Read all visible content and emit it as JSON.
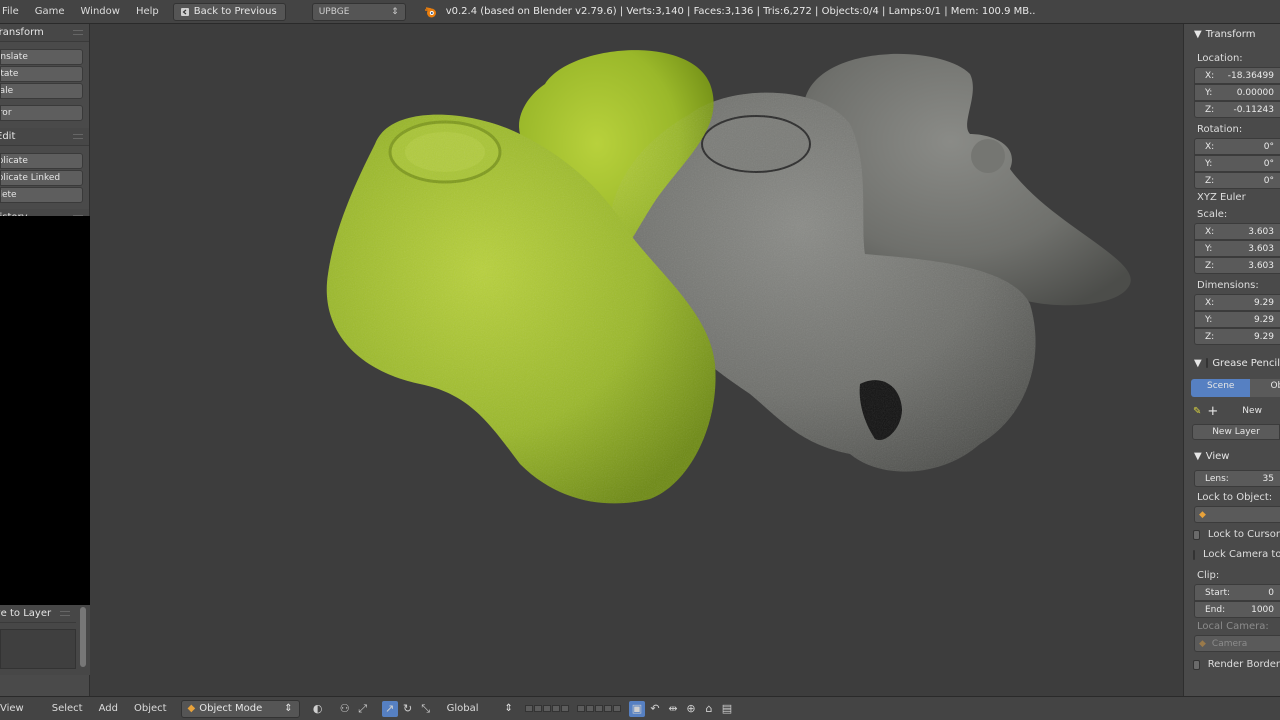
{
  "menu": [
    "File",
    "Game",
    "Window",
    "Help"
  ],
  "back_button": "Back to Previous",
  "engine": "UPBGE",
  "stats": "v0.2.4 (based on Blender v2.79.6) | Verts:3,140 | Faces:3,136 | Tris:6,272 | Objects:0/4 | Lamps:0/1 | Mem: 100.9 MB..",
  "left_panel": {
    "transform_header": "Transform",
    "transform_buttons": [
      "Translate",
      "Rotate",
      "Scale"
    ],
    "mirror": "Mirror",
    "edit_header": "Edit",
    "edit_buttons": [
      "Duplicate",
      "Duplicate Linked",
      "Delete"
    ],
    "history_header": "History",
    "layer_header": "Move to Layer"
  },
  "right_panel": {
    "transform_header": "Transform",
    "location_label": "Location:",
    "location": [
      {
        "axis": "X:",
        "value": "-18.36499"
      },
      {
        "axis": "Y:",
        "value": "0.00000"
      },
      {
        "axis": "Z:",
        "value": "-0.11243"
      }
    ],
    "rotation_label": "Rotation:",
    "rotation": [
      {
        "axis": "X:",
        "value": "0°"
      },
      {
        "axis": "Y:",
        "value": "0°"
      },
      {
        "axis": "Z:",
        "value": "0°"
      }
    ],
    "rotation_mode": "XYZ Euler",
    "scale_label": "Scale:",
    "scale": [
      {
        "axis": "X:",
        "value": "3.603"
      },
      {
        "axis": "Y:",
        "value": "3.603"
      },
      {
        "axis": "Z:",
        "value": "3.603"
      }
    ],
    "dimensions_label": "Dimensions:",
    "dimensions": [
      {
        "axis": "X:",
        "value": "9.29"
      },
      {
        "axis": "Y:",
        "value": "9.29"
      },
      {
        "axis": "Z:",
        "value": "9.29"
      }
    ],
    "grease_header": "Grease Pencil",
    "scene_tab": "Scene",
    "object_tab": "Object",
    "new_label": "New",
    "new_layer": "New Layer",
    "view_header": "View",
    "lens_label": "Lens:",
    "lens_value": "35",
    "lock_object_label": "Lock to Object:",
    "lock_cursor": "Lock to Cursor",
    "lock_camera": "Lock Camera to View",
    "clip_label": "Clip:",
    "clip_start_label": "Start:",
    "clip_start_value": "0",
    "clip_end_label": "End:",
    "clip_end_value": "1000",
    "local_camera_label": "Local Camera:",
    "camera_value": "Camera",
    "render_border": "Render Border"
  },
  "bottom_bar": {
    "items": [
      "View",
      "Select",
      "Add",
      "Object"
    ],
    "mode": "Object Mode",
    "orientation": "Global"
  },
  "colors": {
    "green_object": "#9ab82a",
    "gray_object": "#6f706c",
    "viewport_bg": "#3d3d3d",
    "accent": "#5680c2"
  }
}
